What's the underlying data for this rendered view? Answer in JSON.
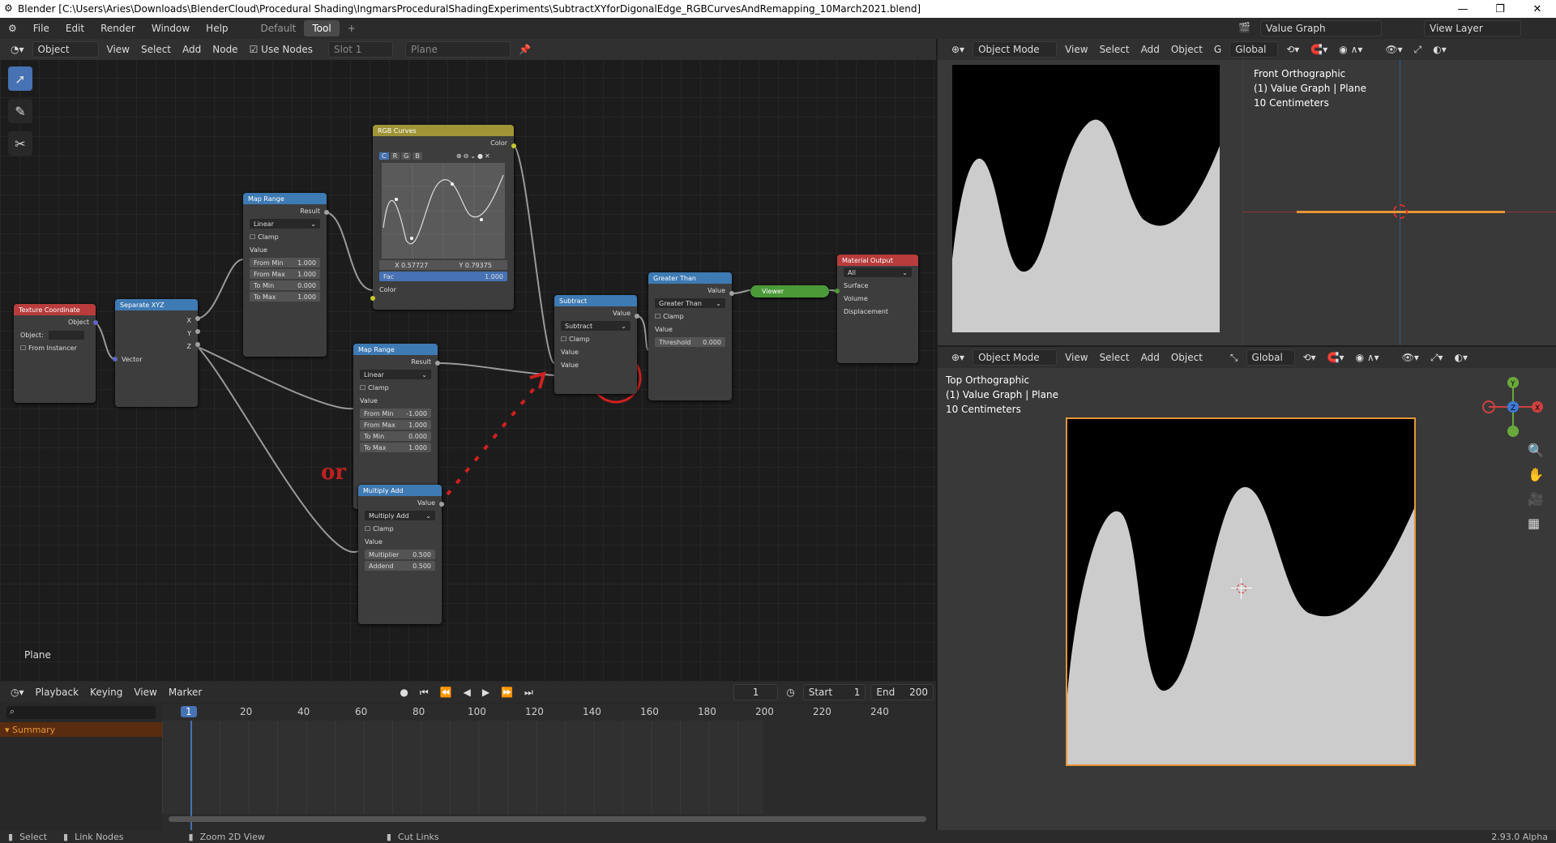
{
  "window": {
    "title": "Blender [C:\\Users\\Aries\\Downloads\\BlenderCloud\\Procedural Shading\\IngmarsProceduralShadingExperiments\\SubtractXYforDigonalEdge_RGBCurvesAndRemapping_10March2021.blend]"
  },
  "menu": {
    "file": "File",
    "edit": "Edit",
    "render": "Render",
    "window": "Window",
    "help": "Help"
  },
  "workspaces": {
    "default": "Default",
    "tool": "Tool",
    "add": "+"
  },
  "scene": {
    "name": "Value Graph",
    "view_layer": "View Layer"
  },
  "node_header": {
    "mode": "Object",
    "view": "View",
    "select": "Select",
    "add": "Add",
    "node": "Node",
    "use_nodes": "Use Nodes",
    "slot": "Slot 1",
    "material": "Plane"
  },
  "nodes": {
    "tex_coord": {
      "title": "Texture Coordinate",
      "out": "Object",
      "object": "Object:",
      "from_instancer": "From Instancer"
    },
    "sep_xyz": {
      "title": "Separate XYZ",
      "x": "X",
      "y": "Y",
      "z": "Z",
      "vector": "Vector"
    },
    "map1": {
      "title": "Map Range",
      "result": "Result",
      "type": "Linear",
      "clamp": "Clamp",
      "value": "Value",
      "from_min": "From Min",
      "from_min_v": "1.000",
      "from_max": "From Max",
      "from_max_v": "1.000",
      "to_min": "To Min",
      "to_min_v": "0.000",
      "to_max": "To Max",
      "to_max_v": "1.000"
    },
    "curves": {
      "title": "RGB Curves",
      "color_out": "Color",
      "c": "C",
      "r": "R",
      "g": "G",
      "b": "B",
      "x": "X 0.57727",
      "y": "Y 0.79375",
      "fac": "Fac",
      "fac_v": "1.000",
      "color_in": "Color"
    },
    "map2": {
      "title": "Map Range",
      "result": "Result",
      "type": "Linear",
      "clamp": "Clamp",
      "value": "Value",
      "from_min": "From Min",
      "from_min_v": "-1.000",
      "from_max": "From Max",
      "from_max_v": "1.000",
      "to_min": "To Min",
      "to_min_v": "0.000",
      "to_max": "To Max",
      "to_max_v": "1.000"
    },
    "madd": {
      "title": "Multiply Add",
      "value_out": "Value",
      "type": "Multiply Add",
      "clamp": "Clamp",
      "value": "Value",
      "mult": "Multiplier",
      "mult_v": "0.500",
      "add": "Addend",
      "add_v": "0.500"
    },
    "subtract": {
      "title": "Subtract",
      "value_out": "Value",
      "type": "Subtract",
      "clamp": "Clamp",
      "v1": "Value",
      "v2": "Value"
    },
    "greater": {
      "title": "Greater Than",
      "value_out": "Value",
      "type": "Greater Than",
      "clamp": "Clamp",
      "value": "Value",
      "threshold": "Threshold",
      "threshold_v": "0.000"
    },
    "viewer": {
      "title": "Viewer"
    },
    "matout": {
      "title": "Material Output",
      "target": "All",
      "surface": "Surface",
      "volume": "Volume",
      "displacement": "Displacement"
    }
  },
  "annotation": {
    "or": "or"
  },
  "node_editor_label": "Plane",
  "vp_header": {
    "mode": "Object Mode",
    "view": "View",
    "select": "Select",
    "add": "Add",
    "object": "Object",
    "orient": "Global",
    "orient_short": "G"
  },
  "vp_front": {
    "title": "Front Orthographic",
    "sub": "(1) Value Graph | Plane",
    "scale": "10 Centimeters"
  },
  "vp_top": {
    "title": "Top Orthographic",
    "sub": "(1) Value Graph | Plane",
    "scale": "10 Centimeters"
  },
  "timeline": {
    "playback": "Playback",
    "keying": "Keying",
    "view": "View",
    "marker": "Marker",
    "frame": "1",
    "start_label": "Start",
    "start": "1",
    "end_label": "End",
    "end": "200",
    "summary": "Summary",
    "ticks": [
      "20",
      "40",
      "60",
      "80",
      "100",
      "120",
      "140",
      "160",
      "180",
      "200",
      "220",
      "240"
    ],
    "current": "1"
  },
  "status": {
    "select": "Select",
    "link": "Link Nodes",
    "zoom": "Zoom 2D View",
    "cut": "Cut Links",
    "version": "2.93.0 Alpha"
  },
  "colors": {
    "input": "#b83c3c",
    "converter": "#3e7ab3",
    "color": "#9f9537",
    "output": "#b83c3c",
    "viewer": "#4b9a38",
    "accent": "#e69636"
  }
}
